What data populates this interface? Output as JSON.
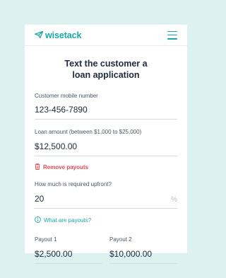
{
  "header": {
    "logo_text": "wisetack"
  },
  "title": "Text the customer a loan application",
  "mobile": {
    "label": "Customer mobile number",
    "value": "123-456-7890"
  },
  "amount": {
    "label": "Loan amount (between $1,000 to $25,000)",
    "value": "$12,500.00"
  },
  "remove_payouts": {
    "label": "Remove payouts",
    "icon": "trash-icon"
  },
  "upfront": {
    "label": "How much is required upfront?",
    "value": "20",
    "unit": "%"
  },
  "payouts_info": {
    "label": "What are payouts?",
    "icon": "info-icon"
  },
  "payouts": [
    {
      "label": "Payout 1",
      "value": "$2,500.00"
    },
    {
      "label": "Payout 2",
      "value": "$10,000.00"
    }
  ],
  "colors": {
    "accent": "#17a9a9",
    "danger": "#e5484d",
    "background": "#ddf2f0"
  }
}
